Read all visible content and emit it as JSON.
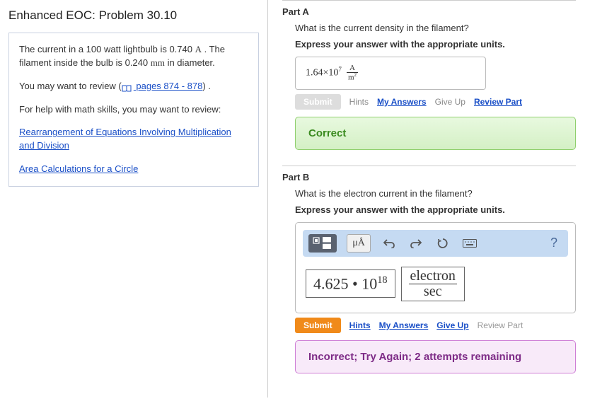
{
  "title": "Enhanced EOC: Problem 30.10",
  "problem": {
    "text1_a": "The current in a 100 watt lightbulb is 0.740 ",
    "text1_unit1": "A",
    "text1_b": " . The filament inside the bulb is 0.240 ",
    "text1_unit2": "mm",
    "text1_c": " in diameter.",
    "text2_a": "You may want to review (",
    "pages_link": " pages 874 - 878",
    "text2_b": ") .",
    "text3": "For help with math skills, you may want to review:",
    "link1": "Rearrangement of Equations Involving Multiplication and Division",
    "link2": "Area Calculations for a Circle"
  },
  "partA": {
    "label": "Part A",
    "question": "What is the current density in the filament?",
    "instruction": "Express your answer with the appropriate units.",
    "answer_coeff": "1.64×10",
    "answer_exp": "7",
    "unit_num": "A",
    "unit_den": "m",
    "unit_den_exp": "2",
    "submit": "Submit",
    "hints": "Hints",
    "my_answers": "My Answers",
    "give_up": "Give Up",
    "review": "Review Part",
    "feedback": "Correct"
  },
  "partB": {
    "label": "Part B",
    "question": "What is the electron current in the filament?",
    "instruction": "Express your answer with the appropriate units.",
    "toolbar": {
      "greek": "μÅ",
      "help": "?"
    },
    "entry_coeff": "4.625 • 10",
    "entry_exp": "18",
    "unit_num": "electron",
    "unit_den": "sec",
    "submit": "Submit",
    "hints": "Hints",
    "my_answers": "My Answers",
    "give_up": "Give Up",
    "review": "Review Part",
    "feedback": "Incorrect; Try Again; 2 attempts remaining"
  }
}
